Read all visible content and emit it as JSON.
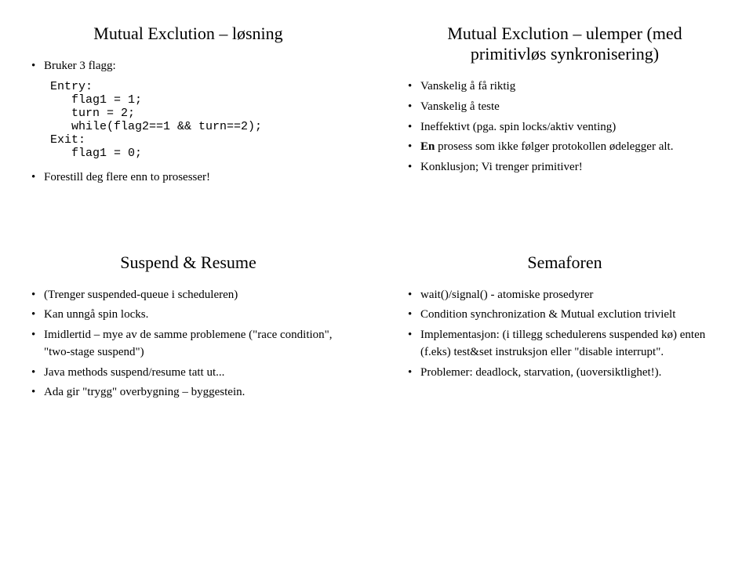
{
  "slides": {
    "tl": {
      "title": "Mutual Exclution – løsning",
      "b1": "Bruker 3 flagg:",
      "code": "Entry:\n   flag1 = 1;\n   turn = 2;\n   while(flag2==1 && turn==2);\nExit:\n   flag1 = 0;",
      "b2": "Forestill deg flere enn to prosesser!"
    },
    "tr": {
      "title": "Mutual Exclution – ulemper (med primitivløs synkronisering)",
      "b1": "Vanskelig å få riktig",
      "b2": "Vanskelig å teste",
      "b3": "Ineffektivt (pga. spin locks/aktiv venting)",
      "b4a": "En",
      "b4b": " prosess som ikke følger protokollen ødelegger alt.",
      "b5": "Konklusjon; Vi trenger primitiver!"
    },
    "bl": {
      "title": "Suspend & Resume",
      "b1": "(Trenger suspended-queue i scheduleren)",
      "b2": "Kan unngå spin locks.",
      "b3": "Imidlertid – mye av de samme problemene (\"race condition\", \"two-stage suspend\")",
      "b4": "Java methods suspend/resume tatt ut...",
      "b5": "Ada gir \"trygg\" overbygning – byggestein."
    },
    "br": {
      "title": "Semaforen",
      "b1": "wait()/signal() - atomiske prosedyrer",
      "b2": "Condition synchronization & Mutual exclution trivielt",
      "b3": "Implementasjon: (i tillegg schedulerens suspended kø) enten (f.eks) test&set instruksjon eller \"disable interrupt\".",
      "b4": "Problemer: deadlock, starvation, (uoversiktlighet!)."
    }
  }
}
